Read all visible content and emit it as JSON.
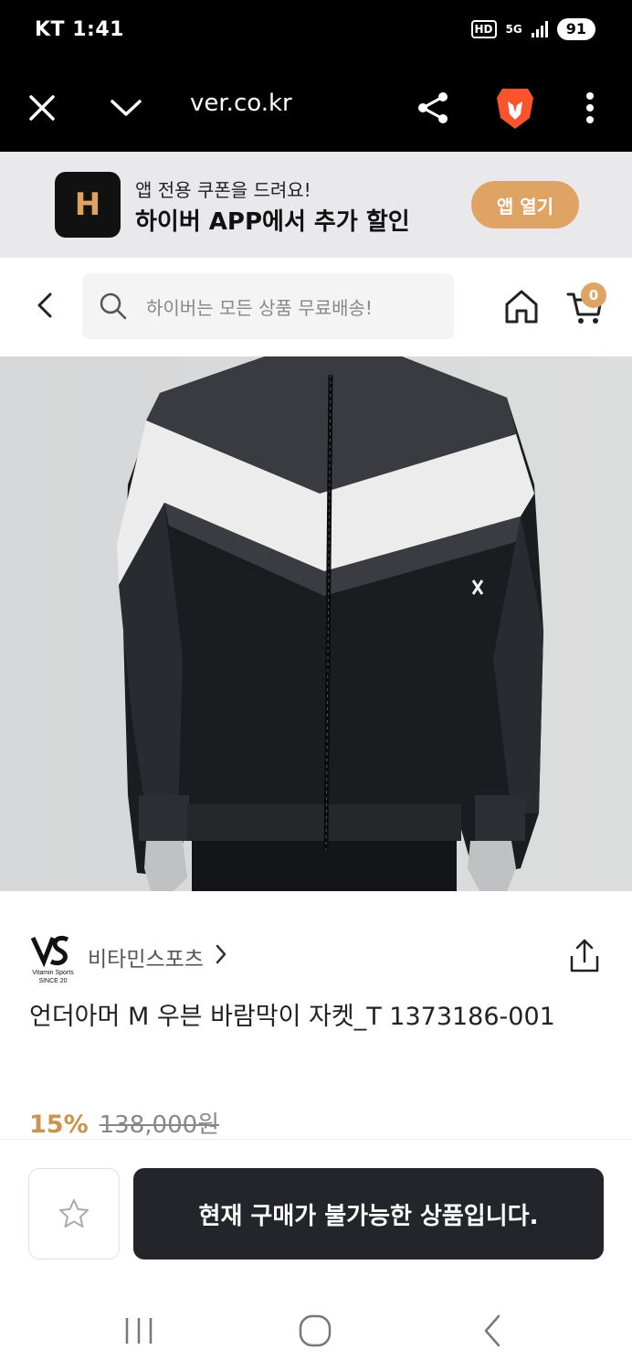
{
  "status_bar": {
    "carrier_time": "KT 1:41",
    "hd": "HD",
    "network": "5G",
    "battery": "91"
  },
  "browser": {
    "url": "ver.co.kr",
    "icons": [
      "close-icon",
      "chevron-down-icon",
      "share-icon",
      "brave-lion-icon",
      "more-vert-icon"
    ]
  },
  "app_banner": {
    "logo_letter": "H",
    "line1": "앱 전용 쿠폰을 드려요!",
    "line2": "하이버 APP에서 추가 할인",
    "button": "앱 열기",
    "accent": "#dfa463"
  },
  "header": {
    "search_placeholder": "하이버는 모든 상품 무료배송!",
    "cart_count": "0",
    "icons": [
      "back-icon",
      "search-icon",
      "home-icon",
      "cart-icon"
    ]
  },
  "product": {
    "seller": "비타민스포츠",
    "seller_logo_text": "Vitamin Sports SINCE 20",
    "title": "언더아머 M 우븐 바람막이 자켓_T 1373186-001",
    "discount": "15%",
    "original_price": "138,000원"
  },
  "bottom_bar": {
    "buy_label": "현재 구매가 불가능한 상품입니다.",
    "buy_bg": "#23252a"
  },
  "nav": {
    "icons": [
      "recents-icon",
      "home-circle-icon",
      "back-nav-icon"
    ]
  }
}
